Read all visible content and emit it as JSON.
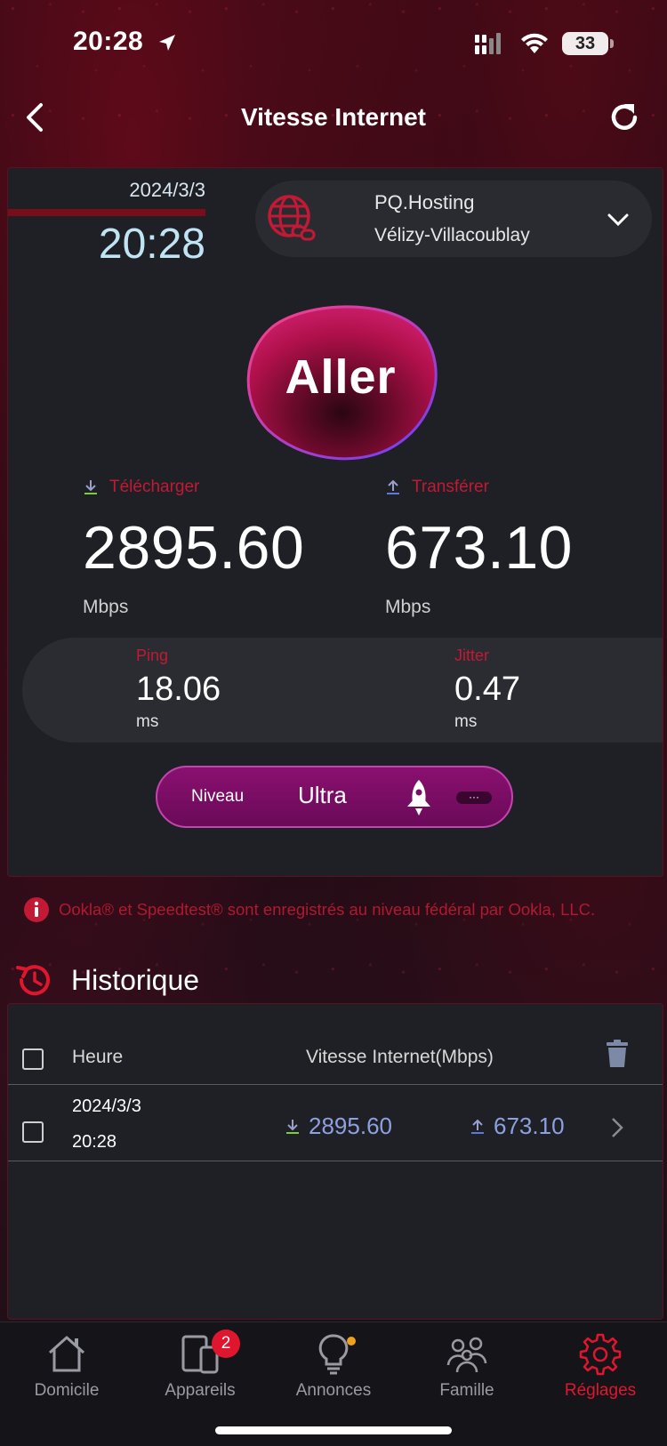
{
  "status_bar": {
    "time": "20:28",
    "battery": "33"
  },
  "nav": {
    "title": "Vitesse Internet"
  },
  "test": {
    "date": "2024/3/3",
    "time": "20:28",
    "server_name": "PQ.Hosting",
    "server_city": "Vélizy-Villacoublay",
    "go_label": "Aller",
    "download_label": "Télécharger",
    "download_value": "2895.60",
    "download_unit": "Mbps",
    "upload_label": "Transférer",
    "upload_value": "673.10",
    "upload_unit": "Mbps",
    "ping_label": "Ping",
    "ping_value": "18.06",
    "ping_unit": "ms",
    "jitter_label": "Jitter",
    "jitter_value": "0.47",
    "jitter_unit": "ms",
    "level_label": "Niveau",
    "level_value": "Ultra",
    "more_label": "···"
  },
  "legal": {
    "text": "Ookla® et Speedtest® sont enregistrés au niveau fédéral par Ookla, LLC."
  },
  "history": {
    "title": "Historique",
    "col_time": "Heure",
    "col_speed": "Vitesse Internet(Mbps)",
    "rows": [
      {
        "date": "2024/3/3",
        "time": "20:28",
        "download": "2895.60",
        "upload": "673.10"
      }
    ]
  },
  "tabs": [
    {
      "label": "Domicile",
      "icon": "home-icon"
    },
    {
      "label": "Appareils",
      "icon": "devices-icon",
      "badge": "2"
    },
    {
      "label": "Annonces",
      "icon": "lightbulb-icon"
    },
    {
      "label": "Famille",
      "icon": "family-icon"
    },
    {
      "label": "Réglages",
      "icon": "gear-icon",
      "active": true
    }
  ],
  "colors": {
    "accent": "#e0162f",
    "label_red": "#c21935",
    "level_purple": "#8a1070",
    "history_value": "#8da0e0"
  }
}
